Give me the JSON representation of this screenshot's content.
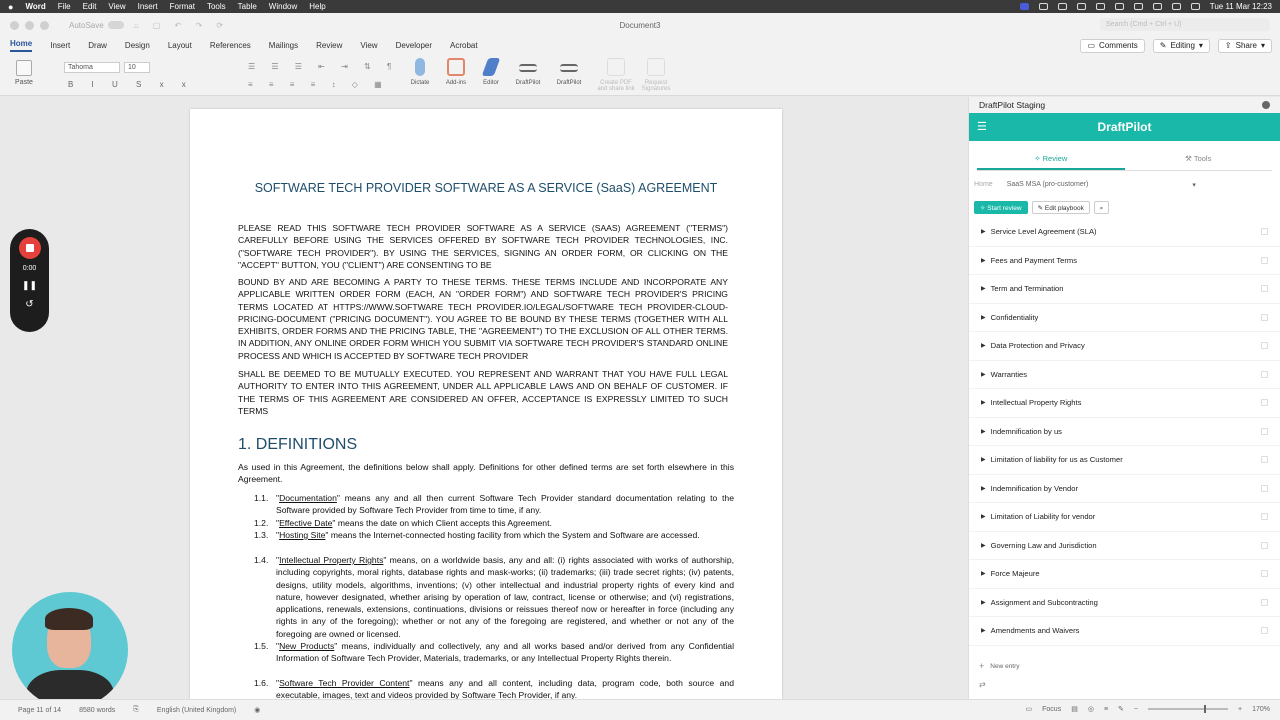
{
  "menubar": {
    "app": "Word",
    "items": [
      "File",
      "Edit",
      "View",
      "Insert",
      "Format",
      "Tools",
      "Table",
      "Window",
      "Help"
    ],
    "clock": "Tue 11 Mar 12:23"
  },
  "titlebar": {
    "autosave": "AutoSave",
    "document": "Document3",
    "search_placeholder": "Search (Cmd + Ctrl + U)"
  },
  "ribbon_tabs": {
    "items": [
      "Home",
      "Insert",
      "Draw",
      "Design",
      "Layout",
      "References",
      "Mailings",
      "Review",
      "View",
      "Developer",
      "Acrobat"
    ],
    "comments": "Comments",
    "editing": "Editing",
    "share": "Share"
  },
  "ribbon": {
    "paste": "Paste",
    "font": "Tahoma",
    "size": "10",
    "dictate": "Dictate",
    "addins": "Add-ins",
    "editor": "Editor",
    "draftpilot1": "DraftPilot",
    "draftpilot2": "DraftPilot",
    "create_pdf": "Create PDF and share link",
    "request_sig": "Request Signatures"
  },
  "document": {
    "title": "SOFTWARE TECH PROVIDER SOFTWARE AS A SERVICE (SaaS) AGREEMENT",
    "para1": "PLEASE READ THIS SOFTWARE TECH PROVIDER SOFTWARE AS A SERVICE (SAAS) AGREEMENT (\"TERMS\") CAREFULLY BEFORE USING THE SERVICES OFFERED BY SOFTWARE TECH PROVIDER TECHNOLOGIES, INC. (\"SOFTWARE TECH PROVIDER\"). BY USING THE SERVICES, SIGNING AN ORDER FORM, OR CLICKING ON THE \"ACCEPT\" BUTTON, YOU (\"CLIENT\") ARE CONSENTING TO BE",
    "para2": "BOUND BY AND ARE BECOMING A PARTY TO THESE TERMS. THESE TERMS INCLUDE AND INCORPORATE ANY APPLICABLE WRITTEN ORDER FORM (EACH, AN \"ORDER FORM\") AND SOFTWARE TECH PROVIDER'S PRICING TERMS LOCATED AT HTTPS://WWW.SOFTWARE TECH PROVIDER.IO/LEGAL/SOFTWARE TECH PROVIDER-CLOUD-PRICING-DOCUMENT (\"PRICING DOCUMENT\"). YOU AGREE TO BE BOUND BY THESE TERMS (TOGETHER WITH ALL EXHIBITS, ORDER FORMS AND THE PRICING TABLE, THE \"AGREEMENT\") TO THE EXCLUSION OF ALL OTHER TERMS. IN ADDITION, ANY ONLINE ORDER FORM WHICH YOU SUBMIT VIA SOFTWARE TECH PROVIDER'S STANDARD ONLINE PROCESS AND WHICH IS ACCEPTED BY SOFTWARE TECH PROVIDER",
    "para3": "SHALL BE DEEMED TO BE MUTUALLY EXECUTED. YOU REPRESENT AND WARRANT THAT YOU HAVE FULL LEGAL AUTHORITY TO ENTER INTO THIS AGREEMENT, UNDER ALL APPLICABLE LAWS AND ON BEHALF OF CUSTOMER. IF THE TERMS OF THIS AGREEMENT ARE CONSIDERED AN OFFER, ACCEPTANCE IS EXPRESSLY LIMITED TO SUCH TERMS",
    "heading": "1. DEFINITIONS",
    "intro": "As used in this Agreement, the definitions below shall apply. Definitions for other defined terms are set forth elsewhere in this Agreement.",
    "defs": [
      {
        "num": "1.1.",
        "term": "Documentation",
        "text": "\" means any and all then current Software Tech Provider standard documentation relating to the Software provided by Software Tech Provider from time to time, if any."
      },
      {
        "num": "1.2.",
        "term": "Effective Date",
        "text": "\" means the date on which Client accepts this Agreement."
      },
      {
        "num": "1.3.",
        "term": "Hosting Site",
        "text": "\" means the Internet-connected hosting facility from which the System and Software are accessed."
      },
      {
        "num": "1.4.",
        "term": "Intellectual Property Rights",
        "text": "\" means, on a worldwide basis, any and all: (i) rights associated with works of authorship, including copyrights, moral rights, database rights and mask-works; (ii) trademarks; (iii) trade secret rights; (iv) patents, designs, utility models, algorithms, inventions; (v) other intellectual and industrial property rights of every kind and nature, however designated, whether arising by operation of law, contract, license or otherwise; and (vi) registrations, applications, renewals, extensions, continuations, divisions or reissues thereof now or hereafter in force (including any rights in any of the foregoing); whether or not any of the foregoing are registered, and whether or not any of the foregoing are owned or licensed."
      },
      {
        "num": "1.5.",
        "term": "New Products",
        "text": "\" means, individually and collectively, any and all works based and/or derived from any Confidential Information of Software Tech Provider, Materials, trademarks, or any Intellectual Property Rights therein."
      },
      {
        "num": "1.6.",
        "term": "Software Tech Provider Content",
        "text": "\" means any and all content, including data, program code, both source and executable, images, text and videos provided by Software Tech Provider, if any."
      }
    ]
  },
  "recorder": {
    "time": "0:00"
  },
  "panel": {
    "window_title": "DraftPilot Staging",
    "brand": "DraftPilot",
    "tab_review": "Review",
    "tab_tools": "Tools",
    "crumb_home": "Home",
    "crumb_playbook": "SaaS MSA (pro-customer)",
    "start_review": "Start review",
    "edit_playbook": "Edit playbook",
    "sections": [
      "Service Level Agreement (SLA)",
      "Fees and Payment Terms",
      "Term and Termination",
      "Confidentiality",
      "Data Protection and Privacy",
      "Warranties",
      "Intellectual Property Rights",
      "Indemnification by us",
      "Limitation of liability for us as Customer",
      "Indemnification by Vendor",
      "Limitation of Liability for vendor",
      "Governing Law and Jurisdiction",
      "Force Majeure",
      "Assignment and Subcontracting",
      "Amendments and Waivers"
    ],
    "new_entry": "New entry"
  },
  "status": {
    "page": "Page 11 of 14",
    "words": "8580 words",
    "language": "English (United Kingdom)",
    "focus": "Focus",
    "zoom": "170%"
  }
}
